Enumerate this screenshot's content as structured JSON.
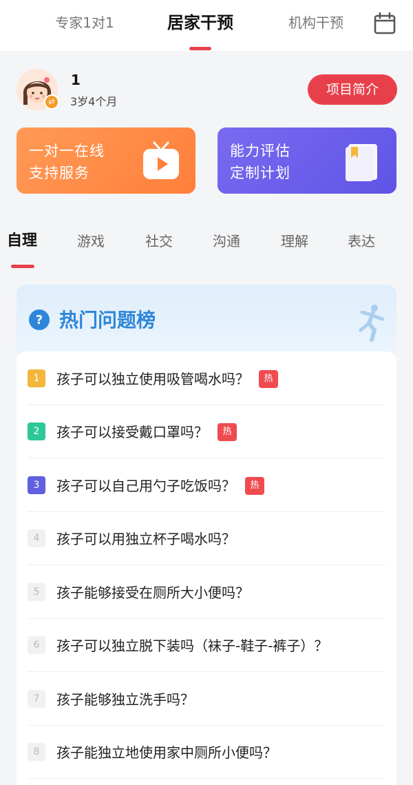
{
  "top_tabs": [
    "专家1对1",
    "居家干预",
    "机构干预"
  ],
  "profile": {
    "name": "1",
    "age": "3岁4个月",
    "intro_button": "项目简介"
  },
  "cards": [
    {
      "line1": "一对一在线",
      "line2": "支持服务",
      "icon": "tv-play-icon"
    },
    {
      "line1": "能力评估",
      "line2": "定制计划",
      "icon": "notebook-icon"
    }
  ],
  "category_tabs": [
    "自理",
    "游戏",
    "社交",
    "沟通",
    "理解",
    "表达"
  ],
  "hot_list": {
    "title": "热门问题榜",
    "hot_label": "热",
    "items": [
      {
        "rank": "1",
        "text": "孩子可以独立使用吸管喝水吗？",
        "hot": true,
        "color": "#f4b63b"
      },
      {
        "rank": "2",
        "text": "孩子可以接受戴口罩吗？",
        "hot": true,
        "color": "#2dc897"
      },
      {
        "rank": "3",
        "text": "孩子可以自己用勺子吃饭吗？",
        "hot": true,
        "color": "#6160e0"
      },
      {
        "rank": "4",
        "text": "孩子可以用独立杯子喝水吗？",
        "hot": false,
        "color": ""
      },
      {
        "rank": "5",
        "text": "孩子能够接受在厕所大小便吗？",
        "hot": false,
        "color": ""
      },
      {
        "rank": "6",
        "text": "孩子可以独立脱下装吗（袜子-鞋子-裤子）？",
        "hot": false,
        "color": ""
      },
      {
        "rank": "7",
        "text": "孩子能够独立洗手吗？",
        "hot": false,
        "color": ""
      },
      {
        "rank": "8",
        "text": "孩子能独立地使用家中厕所小便吗？",
        "hot": false,
        "color": ""
      }
    ]
  },
  "colors": {
    "accent_red": "#e8404a",
    "orange_card": "#ff8a48",
    "purple_card": "#6a5feb",
    "hot_title_blue": "#2d86d8"
  }
}
